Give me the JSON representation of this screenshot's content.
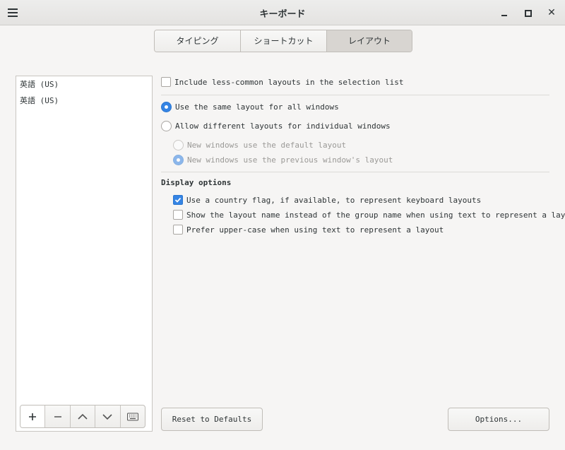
{
  "window": {
    "title": "キーボード"
  },
  "tabs": [
    {
      "label": "タイピング",
      "active": false
    },
    {
      "label": "ショートカット",
      "active": false
    },
    {
      "label": "レイアウト",
      "active": true
    }
  ],
  "layouts_list": {
    "items": [
      "英語 (US)",
      "英語 (US)"
    ],
    "toolbar": [
      "plus-icon",
      "minus-icon",
      "chevron-up-icon",
      "chevron-down-icon",
      "keyboard-icon"
    ]
  },
  "options": {
    "include_less_common": {
      "label": "Include less-common layouts in the selection list",
      "checked": false
    },
    "same_layout": {
      "label": "Use the same layout for all windows",
      "selected": true
    },
    "different_layouts": {
      "label": "Allow different layouts for individual windows",
      "selected": false
    },
    "new_default": {
      "label": "New windows use the default layout",
      "selected": false
    },
    "new_previous": {
      "label": "New windows use the previous window's layout",
      "selected": true
    },
    "display_heading": "Display options",
    "country_flag": {
      "label": "Use a country flag, if available,  to represent keyboard layouts",
      "checked": true
    },
    "show_layout_name": {
      "label": "Show the layout name instead of the group name when using text to represent a layout",
      "checked": false
    },
    "upper_case": {
      "label": "Prefer upper-case when using text to represent a layout",
      "checked": false
    }
  },
  "buttons": {
    "reset": "Reset to Defaults",
    "options": "Options..."
  },
  "colors": {
    "accent": "#3584e4"
  }
}
